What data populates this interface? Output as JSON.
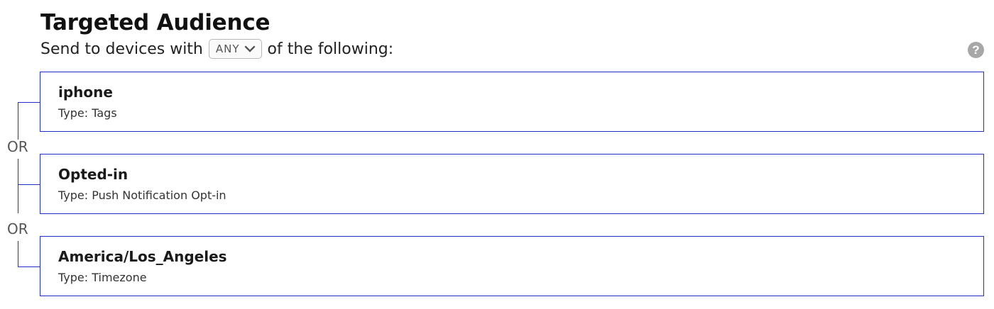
{
  "header": {
    "title": "Targeted Audience",
    "prefix": "Send to devices with",
    "selector_value": "ANY",
    "suffix": "of the following:",
    "help_label": "?"
  },
  "conditions": [
    {
      "name": "iphone",
      "type": "Type: Tags"
    },
    {
      "name": "Opted-in",
      "type": "Type: Push Notification Opt-in"
    },
    {
      "name": "America/Los_Angeles",
      "type": "Type: Timezone"
    }
  ],
  "operators": [
    "OR",
    "OR"
  ],
  "colors": {
    "accent": "#1f2fc8",
    "help_icon": "#a7a7a7"
  },
  "icons": {
    "selector": "chevron-down-icon",
    "help": "question-circle-icon"
  }
}
